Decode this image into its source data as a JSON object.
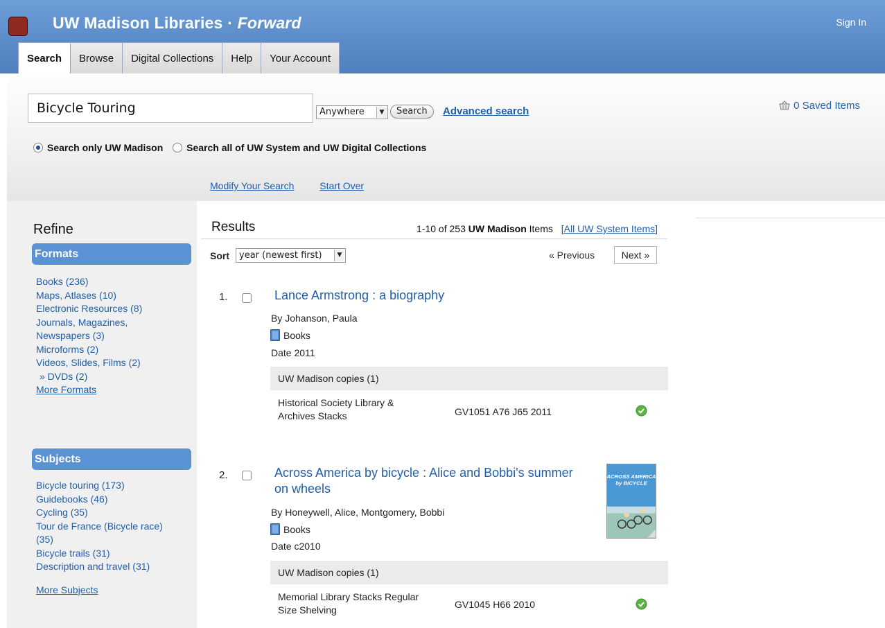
{
  "header": {
    "title_main": "UW Madison Libraries ·",
    "title_accent": "Forward",
    "sign_in": "Sign In"
  },
  "tabs": [
    {
      "label": "Search",
      "active": true
    },
    {
      "label": "Browse"
    },
    {
      "label": "Digital Collections"
    },
    {
      "label": "Help"
    },
    {
      "label": "Your Account"
    }
  ],
  "search": {
    "query": "Bicycle Touring",
    "scope_value": "Anywhere",
    "button_label": "Search",
    "advanced_label": "Advanced search",
    "saved_items": "0 Saved Items",
    "radio_madison": "Search only UW Madison",
    "radio_system": "Search all of UW System and UW Digital Collections",
    "modify_label": "Modify Your Search",
    "start_over_label": "Start Over"
  },
  "sidebar": {
    "refine_title": "Refine",
    "formats_head": "Formats",
    "formats": [
      "Books (236)",
      "Maps, Atlases (10)",
      "Electronic Resources (8)",
      "Journals, Magazines,",
      "Newspapers (3)",
      "Microforms (2)",
      "Videos, Slides, Films (2)",
      "» DVDs (2)"
    ],
    "more_formats": "More Formats",
    "subjects_head": "Subjects",
    "subjects": [
      "Bicycle touring (173)",
      "Guidebooks (46)",
      "Cycling (35)",
      "Tour de France (Bicycle race)",
      "(35)",
      "Bicycle trails (31)",
      "Description and travel (31)"
    ],
    "more_subjects": "More Subjects"
  },
  "results": {
    "title": "Results",
    "count_prefix": "1-10 of 253",
    "count_bold": "UW Madison",
    "count_suffix": "Items",
    "all_system": "[All UW System Items]",
    "sort_label": "Sort",
    "sort_value": "year (newest first)",
    "prev_label": "« Previous",
    "next_label": "Next »",
    "records": [
      {
        "num": "1.",
        "title": "Lance Armstrong : a biography",
        "by": "By Johanson, Paula",
        "format": "Books",
        "date_label": "Date",
        "date": "2011",
        "copies": "UW Madison copies (1)",
        "location_1": "Historical Society Library &",
        "location_2": "Archives Stacks",
        "call_number": "GV1051 A76 J65 2011"
      },
      {
        "num": "2.",
        "title_1": "Across America by bicycle : Alice and Bobbi's summer",
        "title_2": "on wheels",
        "by": "By Honeywell, Alice, Montgomery, Bobbi",
        "format": "Books",
        "date_label": "Date",
        "date": "c2010",
        "copies": "UW Madison copies (1)",
        "location_1": "Memorial Library Stacks Regular",
        "location_2": "Size Shelving",
        "call_number": "GV1045 H66 2010"
      }
    ]
  },
  "colors": {
    "header_blue": "#5b8cc9",
    "link_blue": "#1f5ea8",
    "facet_head_blue": "#5b92d3",
    "logo_red": "#8e2a20",
    "available_green": "#5bb544"
  }
}
